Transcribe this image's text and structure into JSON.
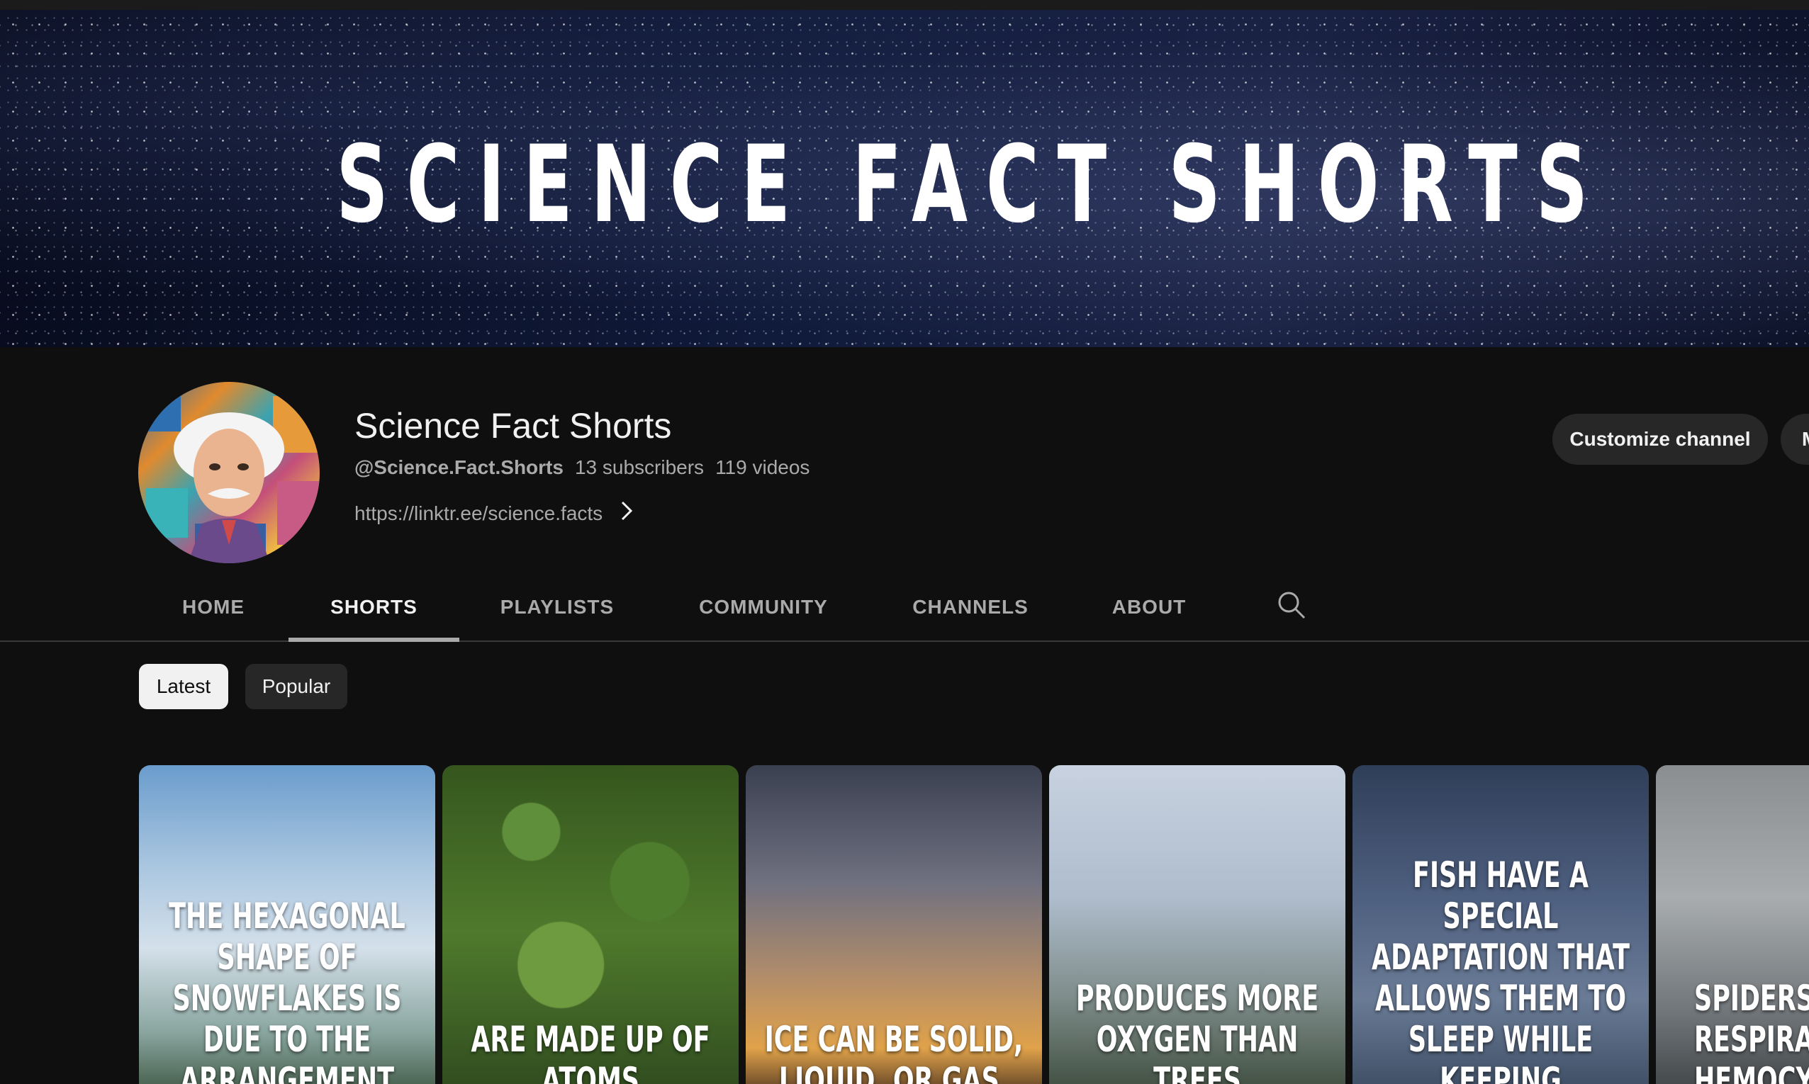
{
  "banner": {
    "title": "SCIENCE FACT SHORTS"
  },
  "channel": {
    "name": "Science Fact Shorts",
    "handle": "@Science.Fact.Shorts",
    "subscribers": "13 subscribers",
    "videos": "119 videos",
    "link": "https://linktr.ee/science.facts",
    "customize_label": "Customize channel",
    "manage_label": "M"
  },
  "tabs": [
    {
      "label": "HOME",
      "active": false
    },
    {
      "label": "SHORTS",
      "active": true
    },
    {
      "label": "PLAYLISTS",
      "active": false
    },
    {
      "label": "COMMUNITY",
      "active": false
    },
    {
      "label": "CHANNELS",
      "active": false
    },
    {
      "label": "ABOUT",
      "active": false
    }
  ],
  "chips": {
    "latest": "Latest",
    "popular": "Popular",
    "selected": "Latest"
  },
  "shorts": [
    {
      "caption": "The hexagonal shape of snowflakes is due to the arrangement"
    },
    {
      "caption": "are made up of atoms"
    },
    {
      "caption": "ice can be solid, liquid, or gas."
    },
    {
      "caption": "produces more oxygen than trees"
    },
    {
      "caption": "Fish have a special adaptation that allows them to sleep while keeping"
    },
    {
      "caption": "Spiders blue-co respira pigment hemocyan"
    }
  ],
  "icons": {
    "search": "search-icon",
    "chevron": "chevron-right-icon"
  }
}
